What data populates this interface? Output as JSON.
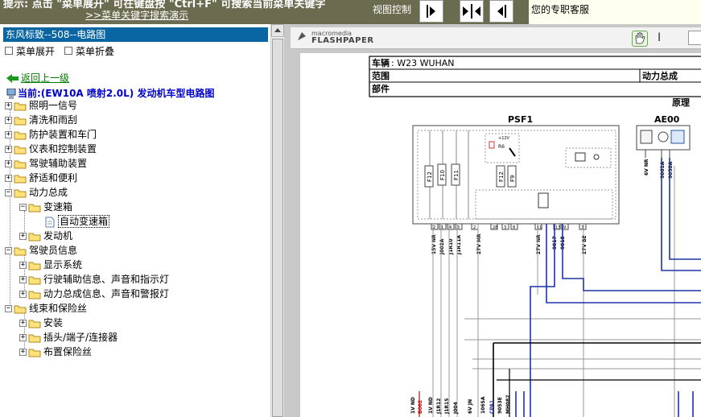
{
  "topbar": {
    "hint": "提示: 点击 \"菜单展开\" 可在键盘按 \"Ctrl+F\" 可搜索当前菜单关键字",
    "search_demo_link": ">>菜单关键字搜索演示",
    "view_control_label": "视图控制",
    "service_label": "您的专职客服",
    "colors": {
      "bar": "#6b6b4f",
      "service_bg": "#fffff0"
    }
  },
  "left_panel": {
    "title": "东风标致--508--电路图",
    "expand_label": "菜单展开",
    "collapse_label": "菜单折叠",
    "back_label": "返回上一级",
    "current_label": "当前:(EW10A 喷射2.0L) 发动机车型电路图",
    "tree": [
      {
        "label": "照明一信号",
        "state": "+"
      },
      {
        "label": "清洗和雨刮",
        "state": "+"
      },
      {
        "label": "防护装置和车门",
        "state": "+"
      },
      {
        "label": "仪表和控制装置",
        "state": "+"
      },
      {
        "label": "驾驶辅助装置",
        "state": "+"
      },
      {
        "label": "舒适和便利",
        "state": "+"
      },
      {
        "label": "动力总成",
        "state": "-"
      },
      {
        "label": "变速箱",
        "state": "-"
      },
      {
        "label": "自动变速箱",
        "state": "leaf"
      },
      {
        "label": "发动机",
        "state": "+"
      },
      {
        "label": "驾驶员信息",
        "state": "-"
      },
      {
        "label": "显示系统",
        "state": "+"
      },
      {
        "label": "行驶辅助信息、声音和指示灯",
        "state": "+"
      },
      {
        "label": "动力总成信息、声音和警报灯",
        "state": "+"
      },
      {
        "label": "线束和保险丝",
        "state": "-"
      },
      {
        "label": "安装",
        "state": "+"
      },
      {
        "label": "插头/端子/连接器",
        "state": "+"
      },
      {
        "label": "布置保险丝",
        "state": "+"
      }
    ]
  },
  "viewer": {
    "brand_small": "macromedia",
    "brand_big": "FLASHPAPER",
    "cursor_tool_icon": "hand-icon",
    "select_tool_icon": "text-cursor-icon"
  },
  "document": {
    "row1_label": "车辆",
    "row1_value": ": W23 WUHAN",
    "row2_label": "范围",
    "row2_value": "动力总成",
    "row3_label": "部件",
    "principle": "原理",
    "box1_name": "PSF1",
    "box2_name": "AE00",
    "relay_voltage": "+12V",
    "relay_name": "R6",
    "fuses": [
      "F12",
      "F10",
      "F11",
      "F12",
      "F9"
    ],
    "psf1_pins": [
      "2",
      "1",
      "4",
      "3",
      "2",
      "28",
      "3",
      "8",
      "11",
      "13",
      "9",
      "3"
    ],
    "psf1_wires": [
      "15V NR",
      "J002A",
      "J1R10",
      "J1R11A",
      "27V MR",
      "27V NR",
      "9017",
      "9018",
      "27V BE"
    ],
    "ae00_wires": [
      "6V NR",
      "9061A",
      "9058A"
    ],
    "bottom_wires": [
      "1V ND",
      "B002",
      "1V ND",
      "J1R12",
      "J1R15",
      "J004",
      "6V JN",
      "106SA",
      "CPA1",
      "9053E",
      "MH082"
    ]
  }
}
